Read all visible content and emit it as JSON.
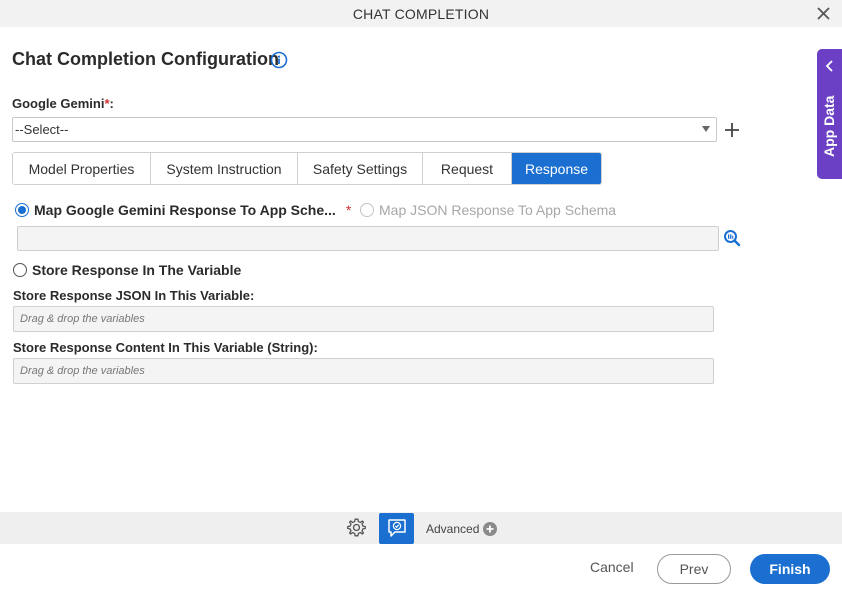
{
  "dialog": {
    "title": "CHAT COMPLETION",
    "heading": "Chat Completion Configuration"
  },
  "gemini_field": {
    "label": "Google Gemini",
    "required_mark": "*",
    "colon": ":",
    "selected": "--Select--"
  },
  "tabs": [
    {
      "label": "Model Properties",
      "active": false
    },
    {
      "label": "System Instruction",
      "active": false
    },
    {
      "label": "Safety Settings",
      "active": false
    },
    {
      "label": "Request",
      "active": false
    },
    {
      "label": "Response",
      "active": true
    }
  ],
  "response": {
    "option_map_gemini": "Map Google Gemini Response To App Sche...",
    "required_mark": "*",
    "option_map_json": "Map JSON Response To App Schema",
    "schema_value": "",
    "option_store_variable": "Store Response In The Variable",
    "store_json_label": "Store Response JSON In This Variable:",
    "store_json_placeholder": "Drag & drop the variables",
    "store_content_label": "Store Response Content In This Variable (String):",
    "store_content_placeholder": "Drag & drop the variables"
  },
  "side_panel": {
    "label": "App Data"
  },
  "toolbar": {
    "advanced_label": "Advanced"
  },
  "footer": {
    "cancel_label": "Cancel",
    "prev_label": "Prev",
    "finish_label": "Finish"
  },
  "colors": {
    "accent": "#1a6fd1",
    "side_panel": "#6b40c4",
    "required": "#d32f2f"
  }
}
